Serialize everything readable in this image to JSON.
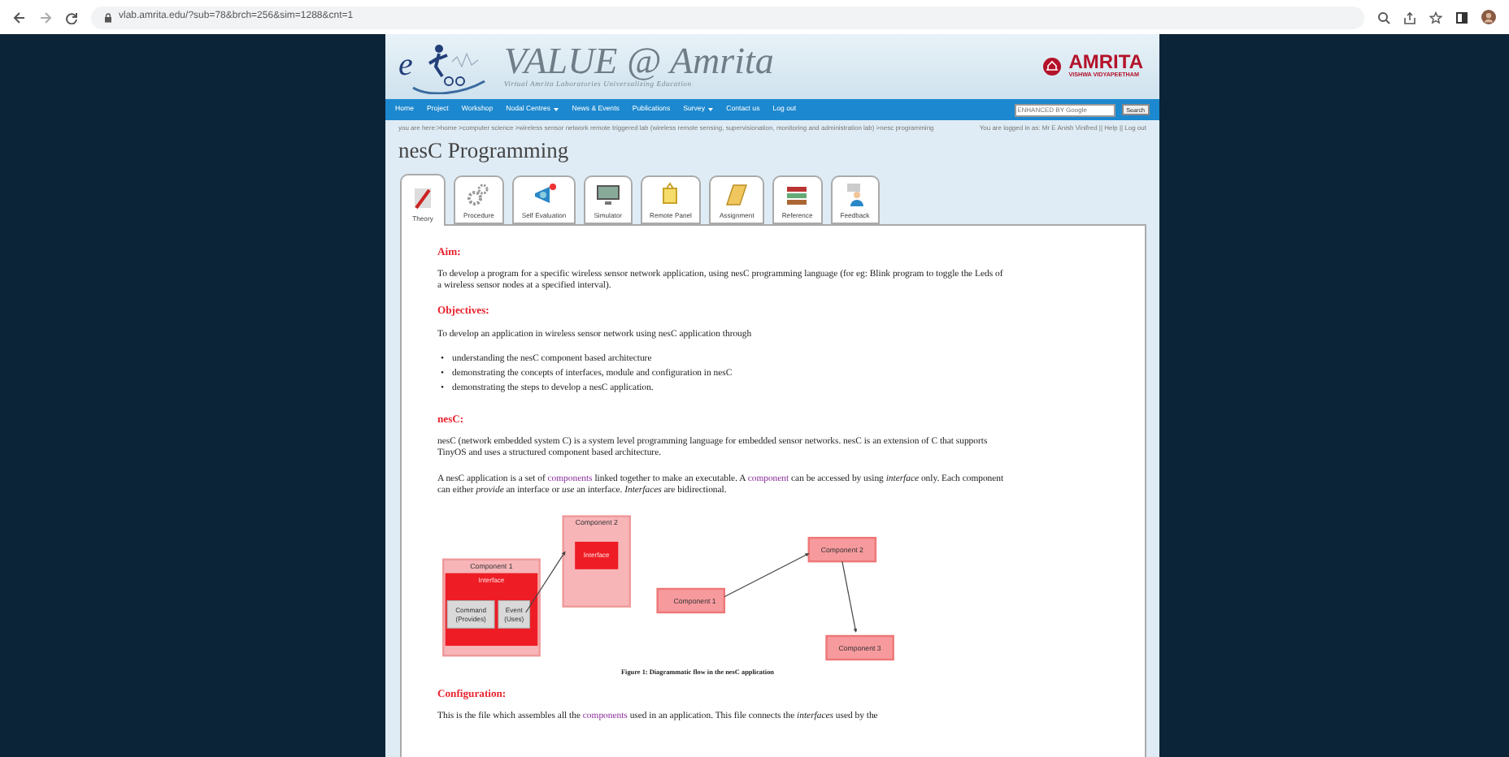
{
  "browser": {
    "url": "vlab.amrita.edu/?sub=78&brch=256&sim=1288&cnt=1"
  },
  "header": {
    "logo_letter": "e",
    "title": "VALUE @ Amrita",
    "tagline": "Virtual Amrita Laboratories Universalizing Education",
    "brand": "AMRITA",
    "brand_sub": "VISHWA VIDYAPEETHAM"
  },
  "nav": [
    {
      "label": "Home",
      "dropdown": false
    },
    {
      "label": "Project",
      "dropdown": false
    },
    {
      "label": "Workshop",
      "dropdown": false
    },
    {
      "label": "Nodal Centres",
      "dropdown": true
    },
    {
      "label": "News & Events",
      "dropdown": false
    },
    {
      "label": "Publications",
      "dropdown": false
    },
    {
      "label": "Survey",
      "dropdown": true
    },
    {
      "label": "Contact us",
      "dropdown": false
    },
    {
      "label": "Log out",
      "dropdown": false
    }
  ],
  "search": {
    "placeholder": "ENHANCED BY Google",
    "button": "Search"
  },
  "breadcrumb": "you are here:>home >computer science >wireless sensor network remote triggered lab (wireless remote sensing, supervisionation, monitoring and administration lab) >nesc programming",
  "login_info": "You are logged in as: Mr E Anish Vinifred  ||  Help  ||  Log out",
  "page_title": "nesC Programming",
  "tabs": [
    {
      "label": "Theory",
      "selected": true
    },
    {
      "label": "Procedure",
      "selected": false
    },
    {
      "label": "Self Evaluation",
      "selected": false
    },
    {
      "label": "Simulator",
      "selected": false
    },
    {
      "label": "Remote Panel",
      "selected": false
    },
    {
      "label": "Assignment",
      "selected": false
    },
    {
      "label": "Reference",
      "selected": false
    },
    {
      "label": "Feedback",
      "selected": false
    }
  ],
  "content": [
    {
      "kind": "heading",
      "text": "Aim:"
    },
    {
      "kind": "para",
      "text": "To develop a program for a specific wireless sensor network application, using nesC programming language (for eg: Blink program to toggle the Leds of a wireless sensor nodes at a specified interval)."
    },
    {
      "kind": "heading",
      "text": "Objectives:"
    },
    {
      "kind": "para",
      "text": "To develop an application in wireless sensor network using nesC application through"
    },
    {
      "kind": "list",
      "bullet": "•",
      "items": [
        "understanding the nesC component based architecture",
        "demonstrating the concepts of interfaces, module and configuration in nesC",
        "demonstrating the steps to develop a nesC application."
      ]
    },
    {
      "kind": "heading",
      "text": "nesC:"
    },
    {
      "kind": "para",
      "text": "nesC (network embedded system C) is a system level programming language for embedded sensor networks. nesC is an  extension of C that supports TinyOS and uses a structured component based architecture."
    },
    {
      "kind": "para",
      "text": "A nesC application is a set of **components** linked together to make an executable. A **component** can be accessed by using *interface* only. Each component can either *provide* an interface or *use* an interface. *Interfaces* are bidirectional."
    },
    {
      "kind": "figure",
      "component_1": {
        "title": "Component 1",
        "interface": "Interface",
        "command": "Command (Provides)",
        "event": "Event (Uses)"
      },
      "component_2": {
        "title": "Component 2",
        "interface": "Interface"
      },
      "nodes": [
        "Component 1",
        "Component 2",
        "Component 3"
      ],
      "caption": "Figure 1: Diagrammatic flow in the nesC application"
    },
    {
      "kind": "heading",
      "text": "Configuration:"
    },
    {
      "kind": "para",
      "text": "This is the file which assembles all the **components** used in an application. This file connects the *interfaces* used by the"
    }
  ]
}
